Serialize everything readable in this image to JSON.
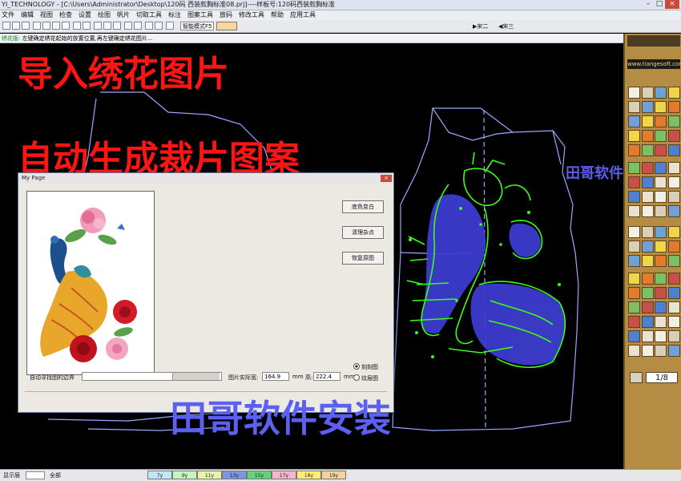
{
  "title_bar": {
    "text": "YI_TECHNOLOGY - [C:\\Users\\Administrator\\Desktop\\120码 西装款胸标准08.prj]----样板号:120码西装款胸标准"
  },
  "menu": [
    "文件",
    "编辑",
    "视图",
    "检查",
    "设置",
    "绘图",
    "帆片",
    "切取工具",
    "标注",
    "图案工具",
    "放码",
    "修改工具",
    "帮助",
    "应用工具"
  ],
  "toolbar": {
    "mode_select": "智能模式F5",
    "right_labels": [
      "▶宋二",
      "◀宋三"
    ]
  },
  "status_hint": {
    "prefix": "绣花版:",
    "text": "左键确定绣花起始的放置位置,再左键确定绣花图片..."
  },
  "overlay": {
    "headline_1": "导入绣花图片",
    "headline_2": "自动生成裁片图案",
    "brand": "田哥软件",
    "install": "田哥软件安装"
  },
  "dialog": {
    "title": "My Page",
    "close_label": "×",
    "buttons": [
      "底色变白",
      "清理杂点",
      "恢复原图"
    ],
    "slider_label": "自动寻找图的边界",
    "size_label": "图片实际宽:",
    "width_value": "164.9",
    "height_value": "222.4",
    "unit": "mm",
    "height_label": "高:",
    "radio_options": [
      "刻刻图",
      "纹层图"
    ],
    "radio_selected": 0
  },
  "right_panel": {
    "logo": "www.tiangesoft.com",
    "page_indicator": "1/8"
  },
  "bottom_bar": {
    "layer_label": "显示层",
    "all_label": "全部",
    "size_tags": [
      "7y",
      "9y",
      "11y",
      "13y",
      "15y",
      "17y",
      "18y",
      "19y"
    ],
    "size_tag_colors": [
      "#bfe7f5",
      "#c7f2c2",
      "#e8f3a8",
      "#7f93e6",
      "#5fd47a",
      "#f5b6cf",
      "#fff073",
      "#f3d39b"
    ]
  },
  "colors": {
    "headline": "#ff1414",
    "brand": "#5a5ee8",
    "embroidery_green": "#39ff14",
    "embroidery_blue": "#3c3ccf",
    "pattern_outline": "#9aa7ff"
  }
}
